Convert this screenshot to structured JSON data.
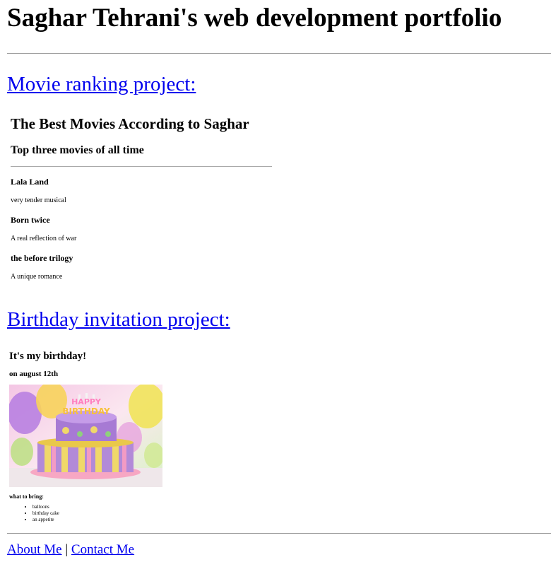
{
  "page": {
    "title": "Saghar Tehrani's web development portfolio"
  },
  "projects": [
    {
      "link_text": "Movie ranking project:"
    },
    {
      "link_text": "Birthday invitation project:"
    }
  ],
  "movie_project": {
    "title": "The Best Movies According to Saghar",
    "subtitle": "Top three movies of all time",
    "movies": [
      {
        "name": "Lala Land",
        "description": "very tender musical"
      },
      {
        "name": "Born twice",
        "description": "A real reflection of war"
      },
      {
        "name": "the before trilogy",
        "description": "A unique romance"
      }
    ]
  },
  "birthday_project": {
    "title": "It's my birthday!",
    "date": "on august 12th",
    "cake_lettering": "HAPPY BIRTHDAY",
    "bring_label": "what to bring:",
    "bring_items": [
      "balloons",
      "birthday cake",
      "an appetite"
    ]
  },
  "footer": {
    "about": "About Me",
    "separator": "|",
    "contact": "Contact Me"
  },
  "colors": {
    "link": "#0000ee",
    "rule": "#999999"
  }
}
